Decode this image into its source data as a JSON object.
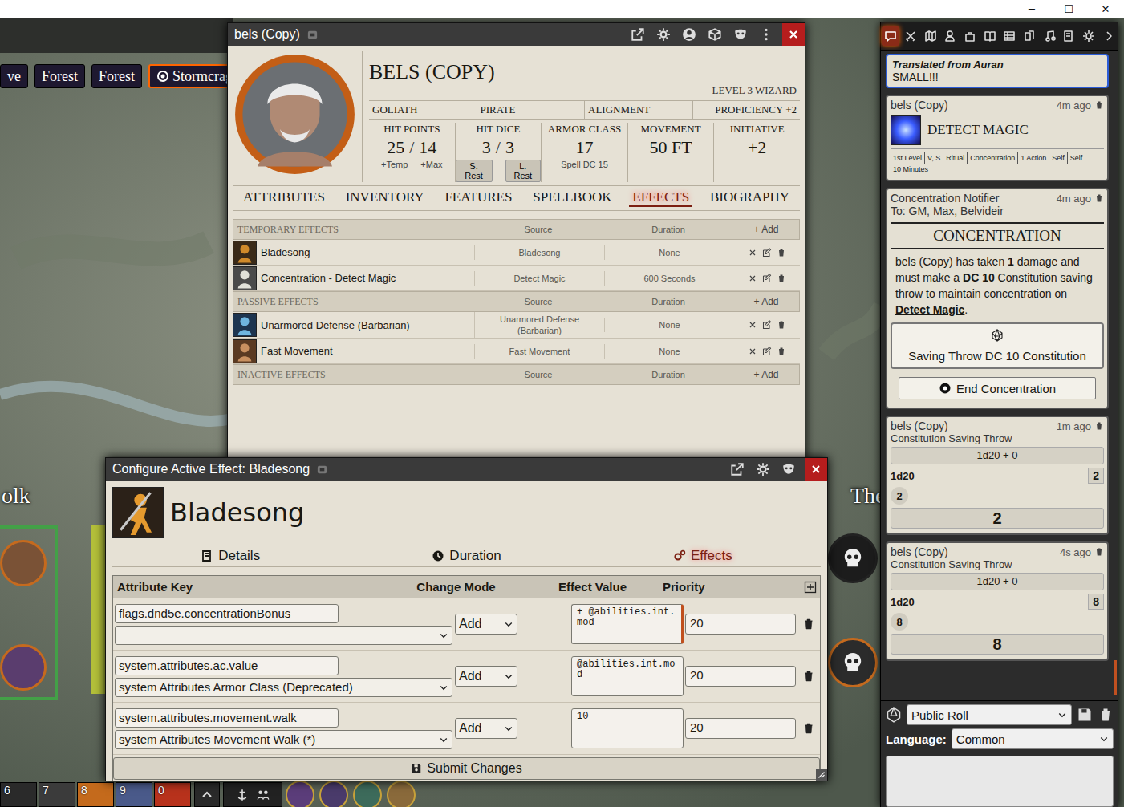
{
  "os_controls": [
    "─",
    "☐",
    "✕"
  ],
  "scene_nav": [
    {
      "label": "ve",
      "selected": false
    },
    {
      "label": "Forest",
      "selected": false
    },
    {
      "label": "Forest",
      "selected": false
    },
    {
      "label": "Stormcrag",
      "selected": true
    }
  ],
  "canvas_labels": [
    "olk",
    "The"
  ],
  "hotbar": {
    "slots": [
      "6",
      "7",
      "8",
      "9",
      "0"
    ]
  },
  "sheet": {
    "title": "bels (Copy)",
    "name": "BELS (COPY)",
    "class_level": "LEVEL 3 WIZARD",
    "details": [
      "GOLIATH",
      "PIRATE",
      "ALIGNMENT",
      "PROFICIENCY +2"
    ],
    "stats": [
      {
        "kind": "hp",
        "label": "HIT POINTS",
        "value": "25",
        "separator": "/",
        "max": "14",
        "subs": [
          "+Temp",
          "+Max"
        ]
      },
      {
        "kind": "dice",
        "label": "HIT DICE",
        "value": "3",
        "separator": "/",
        "max": "3",
        "subs": [
          "S. Rest",
          "L. Rest"
        ]
      },
      {
        "kind": "plain",
        "label": "ARMOR CLASS",
        "value": "17",
        "separator": "",
        "max": "",
        "subs": [
          "Spell DC 15"
        ]
      },
      {
        "kind": "plain",
        "label": "MOVEMENT",
        "value": "50 FT",
        "separator": "",
        "max": "",
        "subs": []
      },
      {
        "kind": "plain",
        "label": "INITIATIVE",
        "value": "+2",
        "separator": "",
        "max": "",
        "subs": []
      }
    ],
    "tabs": [
      {
        "label": "ATTRIBUTES",
        "selected": false
      },
      {
        "label": "INVENTORY",
        "selected": false
      },
      {
        "label": "FEATURES",
        "selected": false
      },
      {
        "label": "SPELLBOOK",
        "selected": false
      },
      {
        "label": "EFFECTS",
        "selected": true
      },
      {
        "label": "BIOGRAPHY",
        "selected": false
      }
    ],
    "sections": [
      {
        "title": "TEMPORARY EFFECTS",
        "source_label": "Source",
        "duration_label": "Duration",
        "add": "+ Add",
        "rows": [
          {
            "name": "Bladesong",
            "source": "Bladesong",
            "duration": "None"
          },
          {
            "name": "Concentration - Detect Magic",
            "source": "Detect Magic",
            "duration": "600 Seconds"
          }
        ]
      },
      {
        "title": "PASSIVE EFFECTS",
        "source_label": "Source",
        "duration_label": "Duration",
        "add": "+ Add",
        "rows": [
          {
            "name": "Unarmored Defense (Barbarian)",
            "source": "Unarmored Defense (Barbarian)",
            "duration": "None"
          },
          {
            "name": "Fast Movement",
            "source": "Fast Movement",
            "duration": "None"
          }
        ]
      },
      {
        "title": "INACTIVE EFFECTS",
        "source_label": "Source",
        "duration_label": "Duration",
        "add": "+ Add",
        "rows": []
      }
    ]
  },
  "effect_config": {
    "title": "Configure Active Effect: Bladesong",
    "name": "Bladesong",
    "tabs": [
      {
        "label": "Details",
        "selected": false
      },
      {
        "label": "Duration",
        "selected": false
      },
      {
        "label": "Effects",
        "selected": true
      }
    ],
    "columns": [
      "Attribute Key",
      "Change Mode",
      "Effect Value",
      "Priority"
    ],
    "changes": [
      {
        "key": "flags.dnd5e.concentrationBonus",
        "select": "",
        "mode": "Add",
        "value": "+ @abilities.int.mod",
        "priority": "20"
      },
      {
        "key": "system.attributes.ac.value",
        "select": "system Attributes Armor Class (Deprecated)",
        "mode": "Add",
        "value": "@abilities.int.mod",
        "priority": "20"
      },
      {
        "key": "system.attributes.movement.walk",
        "select": "system Attributes Movement Walk (*)",
        "mode": "Add",
        "value": "10",
        "priority": "20"
      }
    ],
    "submit": "Submit Changes"
  },
  "sidebar": {
    "tabs": [
      {
        "selected": true
      },
      {
        "selected": false
      },
      {
        "selected": false
      },
      {
        "selected": false
      },
      {
        "selected": false
      },
      {
        "selected": false
      },
      {
        "selected": false
      },
      {
        "selected": false
      },
      {
        "selected": false
      },
      {
        "selected": false
      },
      {
        "selected": false
      },
      {
        "selected": false
      }
    ],
    "messages": [
      {
        "kind": "translation",
        "note": "Translated from Auran",
        "text": "SMALL!!!"
      },
      {
        "kind": "spell",
        "sender": "bels (Copy)",
        "time": "4m ago",
        "title": "DETECT MAGIC",
        "tags": [
          "1st Level",
          "V, S",
          "Ritual",
          "Concentration",
          "1 Action",
          "Self",
          "Self",
          "10 Minutes"
        ]
      },
      {
        "kind": "concentration",
        "sender": "Concentration Notifier",
        "time": "4m ago",
        "whisper": "To: GM, Max, Belvideir",
        "title": "CONCENTRATION",
        "body": [
          {
            "text": "bels (Copy) has taken ",
            "bold": false,
            "underline": false
          },
          {
            "text": "1",
            "bold": true,
            "underline": false
          },
          {
            "text": " damage and must make a ",
            "bold": false,
            "underline": false
          },
          {
            "text": "DC 10",
            "bold": true,
            "underline": false
          },
          {
            "text": " Constitution saving throw to maintain concentration on ",
            "bold": false,
            "underline": false
          },
          {
            "text": "Detect Magic",
            "bold": true,
            "underline": true
          },
          {
            "text": ".",
            "bold": false,
            "underline": false
          }
        ],
        "actions": [
          "Saving Throw DC 10 Constitution",
          "End Concentration"
        ]
      },
      {
        "kind": "roll",
        "sender": "bels (Copy)",
        "time": "1m ago",
        "flavor": "Constitution Saving Throw",
        "formula": "1d20 + 0",
        "dice_label": "1d20",
        "subtotal": "2",
        "dice": [
          "2"
        ],
        "total": "2"
      },
      {
        "kind": "roll",
        "sender": "bels (Copy)",
        "time": "4s ago",
        "flavor": "Constitution Saving Throw",
        "formula": "1d20 + 0",
        "dice_label": "1d20",
        "subtotal": "8",
        "dice": [
          "8"
        ],
        "total": "8"
      }
    ],
    "roll_mode": "Public Roll",
    "language_label": "Language:",
    "language": "Common"
  }
}
